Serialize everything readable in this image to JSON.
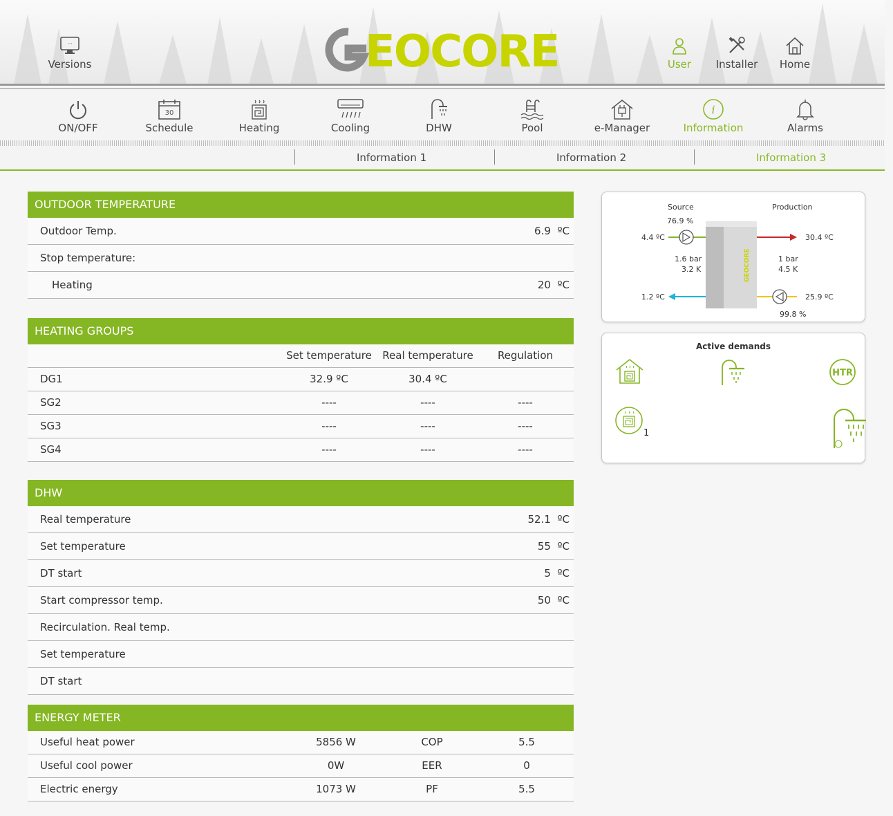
{
  "header": {
    "versions_label": "Versions",
    "logo_text": "GEOCORE",
    "user_label": "User",
    "installer_label": "Installer",
    "home_label": "Home"
  },
  "nav": [
    {
      "label": "ON/OFF",
      "icon": "power-icon"
    },
    {
      "label": "Schedule",
      "icon": "calendar-icon",
      "badge": "30"
    },
    {
      "label": "Heating",
      "icon": "heating-icon"
    },
    {
      "label": "Cooling",
      "icon": "cooling-icon"
    },
    {
      "label": "DHW",
      "icon": "shower-icon"
    },
    {
      "label": "Pool",
      "icon": "pool-icon"
    },
    {
      "label": "e-Manager",
      "icon": "house-plug-icon"
    },
    {
      "label": "Information",
      "icon": "info-icon",
      "active": true
    },
    {
      "label": "Alarms",
      "icon": "bell-icon"
    }
  ],
  "subnav": [
    "Information 1",
    "Information 2",
    "Information 3"
  ],
  "outdoor": {
    "title": "OUTDOOR TEMPERATURE",
    "rows": [
      {
        "label": "Outdoor Temp.",
        "value": "6.9",
        "unit": "ºC"
      },
      {
        "label": "Stop temperature:",
        "value": "",
        "unit": ""
      },
      {
        "label": "Heating",
        "value": "20",
        "unit": "ºC"
      }
    ]
  },
  "groups": {
    "title": "HEATING GROUPS",
    "headers": [
      "Set temperature",
      "Real temperature",
      "Regulation"
    ],
    "rows": [
      {
        "name": "DG1",
        "set": "32.9 ºC",
        "real": "30.4 ºC",
        "reg": ""
      },
      {
        "name": "SG2",
        "set": "----",
        "real": "----",
        "reg": "----"
      },
      {
        "name": "SG3",
        "set": "----",
        "real": "----",
        "reg": "----"
      },
      {
        "name": "SG4",
        "set": "----",
        "real": "----",
        "reg": "----"
      }
    ]
  },
  "dhw": {
    "title": "DHW",
    "rows": [
      {
        "label": "Real temperature",
        "value": "52.1",
        "unit": "ºC"
      },
      {
        "label": "Set temperature",
        "value": "55",
        "unit": "ºC"
      },
      {
        "label": "DT start",
        "value": "5",
        "unit": "ºC"
      },
      {
        "label": "Start compressor temp.",
        "value": "50",
        "unit": "ºC"
      },
      {
        "label": "Recirculation. Real temp.",
        "value": "",
        "unit": ""
      },
      {
        "label": "Set temperature",
        "value": "",
        "unit": ""
      },
      {
        "label": "DT start",
        "value": "",
        "unit": ""
      }
    ]
  },
  "energy": {
    "title": "ENERGY METER",
    "rows": [
      {
        "label": "Useful heat power",
        "value": "5856 W",
        "metric": "COP",
        "mvalue": "5.5"
      },
      {
        "label": "Useful cool power",
        "value": "0W",
        "metric": "EER",
        "mvalue": "0"
      },
      {
        "label": "Electric energy",
        "value": "1073 W",
        "metric": "PF",
        "mvalue": "5.5"
      }
    ]
  },
  "diagram": {
    "source_label": "Source",
    "production_label": "Production",
    "source_pct": "76.9 %",
    "source_in": "4.4 ºC",
    "source_out": "1.2 ºC",
    "source_bar": "1.6 bar",
    "source_k": "3.2 K",
    "prod_out": "30.4 ºC",
    "prod_in": "25.9 ºC",
    "prod_bar": "1 bar",
    "prod_k": "4.5 K",
    "prod_pct": "99.8 %",
    "unit_brand": "GEOCORE"
  },
  "demands": {
    "title": "Active demands",
    "htr_label": "HTR",
    "group_count": "1"
  },
  "colors": {
    "accent": "#85b623",
    "hot": "#c62828",
    "cold": "#1fb3d6",
    "warm": "#f2c318"
  }
}
